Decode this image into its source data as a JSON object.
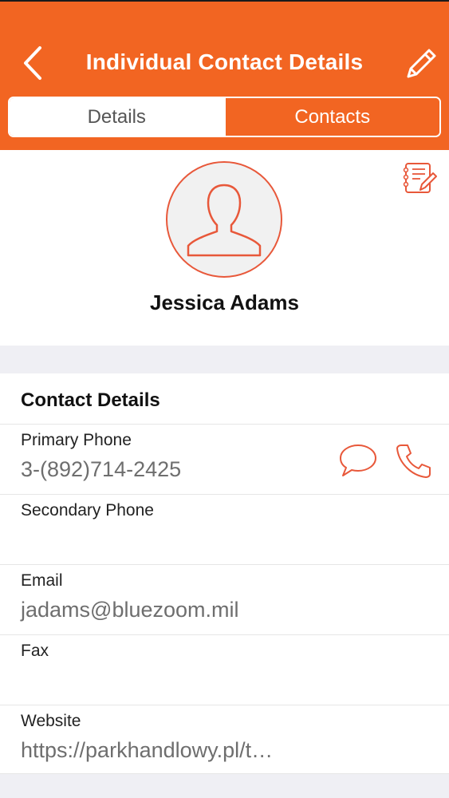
{
  "header": {
    "title": "Individual Contact Details",
    "back_icon": "chevron-left-icon",
    "edit_icon": "pencil-icon",
    "accent_color": "#f26522"
  },
  "tabs": [
    {
      "label": "Details",
      "selected": true
    },
    {
      "label": "Contacts",
      "selected": false
    }
  ],
  "profile": {
    "name": "Jessica Adams",
    "avatar_icon": "person-silhouette-icon",
    "notes_icon": "notebook-edit-icon"
  },
  "contact_details": {
    "title": "Contact Details",
    "fields": [
      {
        "label": "Primary Phone",
        "value": "3-(892)714-2425",
        "actions": [
          "message-icon",
          "phone-icon"
        ]
      },
      {
        "label": "Secondary Phone",
        "value": ""
      },
      {
        "label": "Email",
        "value": "jadams@bluezoom.mil"
      },
      {
        "label": "Fax",
        "value": ""
      },
      {
        "label": "Website",
        "value": "https://parkhandlowy.pl/t…"
      }
    ]
  }
}
